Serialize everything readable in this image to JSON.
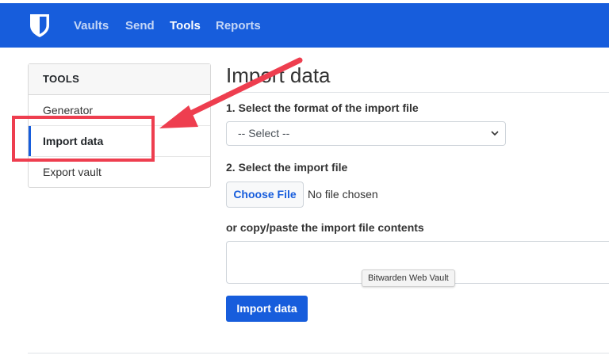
{
  "nav": {
    "items": [
      {
        "label": "Vaults"
      },
      {
        "label": "Send"
      },
      {
        "label": "Tools"
      },
      {
        "label": "Reports"
      }
    ],
    "active": "Tools",
    "color": "#175ddc"
  },
  "sidebar": {
    "header": "TOOLS",
    "items": [
      {
        "label": "Generator"
      },
      {
        "label": "Import data"
      },
      {
        "label": "Export vault"
      }
    ],
    "active": "Import data"
  },
  "main": {
    "title": "Import data",
    "step1_label": "1. Select the format of the import file",
    "format_select_value": "-- Select --",
    "step2_label": "2. Select the import file",
    "choose_file_label": "Choose File",
    "file_status": "No file chosen",
    "paste_label": "or copy/paste the import file contents",
    "tooltip": "Bitwarden Web Vault",
    "import_button": "Import data"
  },
  "annotation": {
    "color": "#ee3e4f"
  }
}
